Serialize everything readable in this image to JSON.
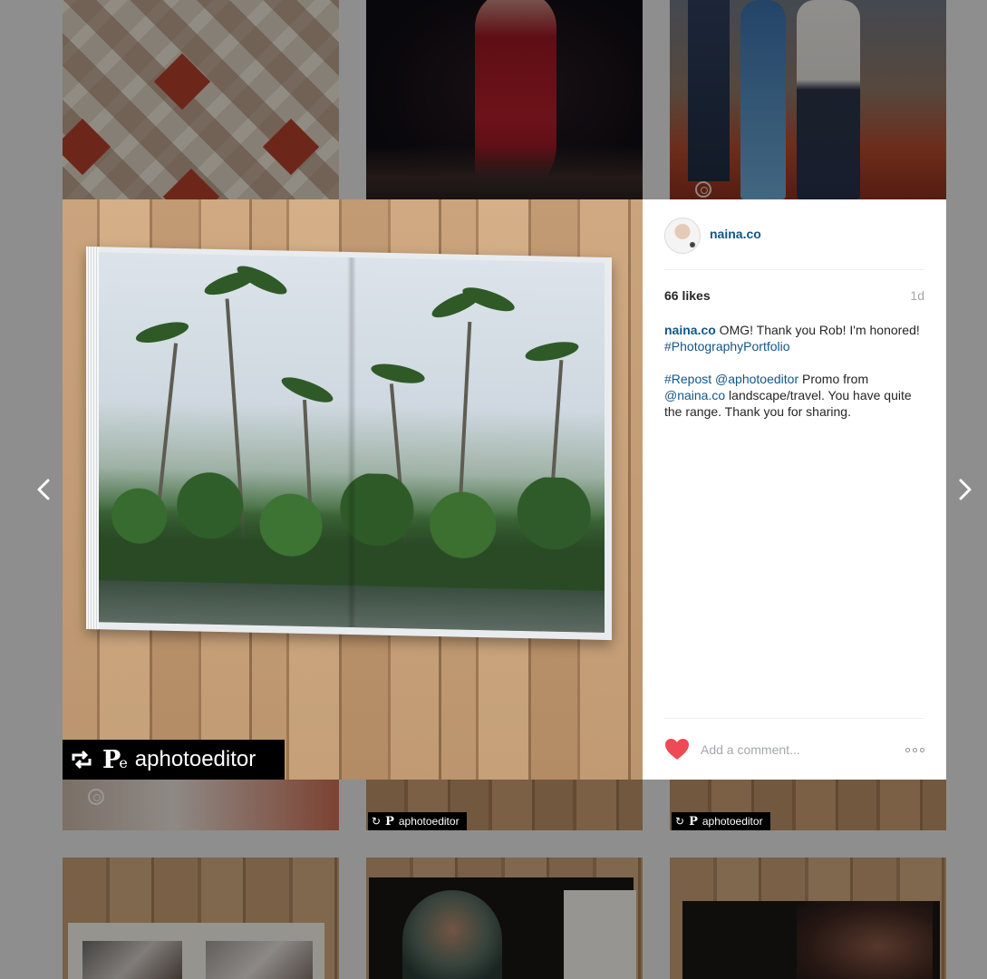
{
  "post": {
    "username": "naina.co",
    "likes": "66 likes",
    "time": "1d",
    "caption": {
      "author": "naina.co",
      "line1_text": " OMG! Thank you Rob! I'm honored! ",
      "hashtag1": "#PhotographyPortfolio",
      "hashtag2": "#Repost",
      "mention1": "@aphotoeditor",
      "line2_text": " Promo from ",
      "mention2": "@naina.co",
      "line3_text": " landscape/travel. You have quite the range. Thank you for sharing."
    },
    "comment_placeholder": "Add a comment...",
    "overlay": {
      "repost_user": "aphotoeditor",
      "logo_letters": "P",
      "logo_sub": "e"
    }
  },
  "grid": {
    "repost_labels": [
      "aphotoeditor",
      "aphotoeditor"
    ]
  },
  "colors": {
    "link": "#125688",
    "heart": "#ed4956",
    "overlay_bg": "#8e8e8e"
  },
  "icons": {
    "prev": "chevron-left-icon",
    "next": "chevron-right-icon",
    "repost": "repost-icon",
    "like": "heart-icon",
    "more": "more-options-icon",
    "camera": "camera-icon"
  }
}
